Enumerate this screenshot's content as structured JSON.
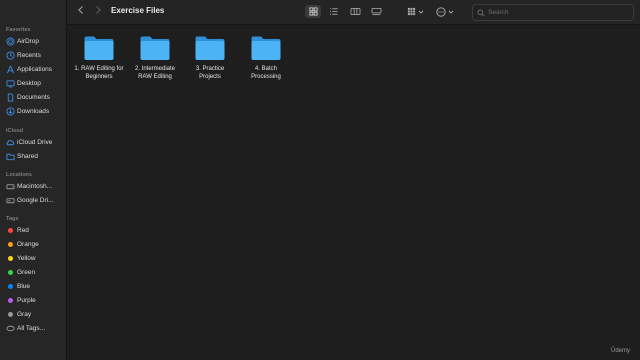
{
  "window": {
    "title": "Exercise Files"
  },
  "sidebar": {
    "sections": {
      "favorites": "Favorites",
      "icloud": "iCloud",
      "locations": "Locations",
      "tags": "Tags"
    },
    "favorites": [
      {
        "label": "AirDrop",
        "icon": "airdrop-icon"
      },
      {
        "label": "Recents",
        "icon": "clock-icon"
      },
      {
        "label": "Applications",
        "icon": "applications-icon"
      },
      {
        "label": "Desktop",
        "icon": "desktop-icon"
      },
      {
        "label": "Documents",
        "icon": "document-icon"
      },
      {
        "label": "Downloads",
        "icon": "downloads-icon"
      }
    ],
    "icloud": [
      {
        "label": "iCloud Drive",
        "icon": "cloud-icon"
      },
      {
        "label": "Shared",
        "icon": "shared-folder-icon"
      }
    ],
    "locations": [
      {
        "label": "Macintosh...",
        "icon": "disk-icon"
      },
      {
        "label": "Google Dri...",
        "icon": "drive-icon"
      }
    ],
    "tags": [
      {
        "label": "Red",
        "color": "#ff453a"
      },
      {
        "label": "Orange",
        "color": "#ff9f0a"
      },
      {
        "label": "Yellow",
        "color": "#ffd60a"
      },
      {
        "label": "Green",
        "color": "#32d74b"
      },
      {
        "label": "Blue",
        "color": "#0a84ff"
      },
      {
        "label": "Purple",
        "color": "#bf5af2"
      },
      {
        "label": "Gray",
        "color": "#98989d"
      },
      {
        "label": "All Tags...",
        "icon": "all-tags-icon"
      }
    ]
  },
  "toolbar": {
    "search_placeholder": "Search"
  },
  "files": [
    {
      "line1": "1. RAW Editing for",
      "line2": "Beginners"
    },
    {
      "line1": "2. Intermediate",
      "line2": "RAW Editing"
    },
    {
      "line1": "3. Practice",
      "line2": "Projects"
    },
    {
      "line1": "4. Batch",
      "line2": "Processing"
    }
  ],
  "colors": {
    "accent": "#0a84ff",
    "folder": "#3ea8f0"
  },
  "watermark": "Ūdemy"
}
